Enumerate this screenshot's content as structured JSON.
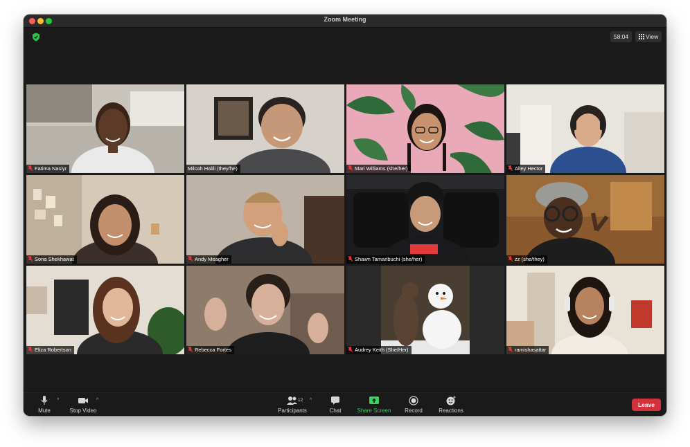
{
  "window": {
    "title": "Zoom Meeting"
  },
  "header": {
    "timer": "58:04",
    "view_label": "View"
  },
  "participants": [
    {
      "name": "Fatima Nasiyr",
      "muted": true
    },
    {
      "name": "Milcah Halili (they/he)",
      "muted": false
    },
    {
      "name": "Mari Williams (she/her)",
      "muted": true
    },
    {
      "name": "Alley Hector",
      "muted": true
    },
    {
      "name": "Sona Shekhawat",
      "muted": true,
      "active_speaker": true
    },
    {
      "name": "Andy Meagher",
      "muted": true
    },
    {
      "name": "Shawn Tamaribuchi (she/her)",
      "muted": true
    },
    {
      "name": "zz (she/they)",
      "muted": true
    },
    {
      "name": "Eliza Robertson",
      "muted": true
    },
    {
      "name": "Rebecca Fortes",
      "muted": true
    },
    {
      "name": "Audrey Keith (She/Her)",
      "muted": true
    },
    {
      "name": "ramishasattar",
      "muted": true
    }
  ],
  "toolbar": {
    "mute_label": "Mute",
    "stop_video_label": "Stop Video",
    "participants_label": "Participants",
    "participants_count": "12",
    "chat_label": "Chat",
    "share_screen_label": "Share Screen",
    "record_label": "Record",
    "reactions_label": "Reactions",
    "leave_label": "Leave"
  },
  "colors": {
    "accent_green": "#3ad05c",
    "leave_red": "#d3323b",
    "active_border": "#c9e36b"
  }
}
